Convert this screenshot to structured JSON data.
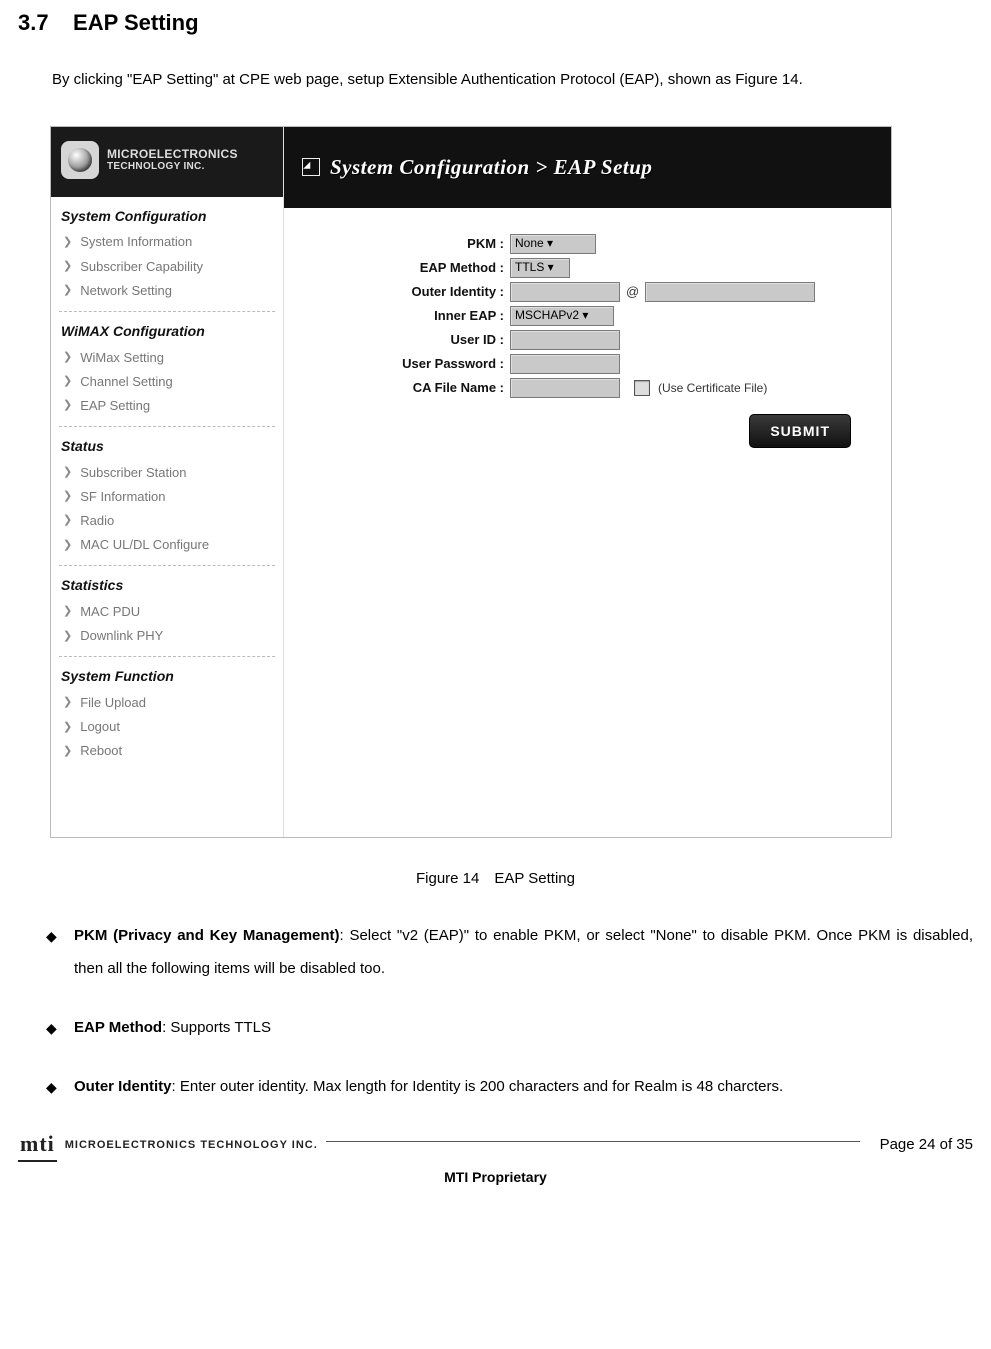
{
  "section_number": "3.7",
  "section_title": "EAP Setting",
  "intro": "By clicking \"EAP Setting\" at CPE web page, setup Extensible Authentication Protocol (EAP), shown as Figure 14.",
  "brand_line1": "MICROELECTRONICS",
  "brand_line2": "TECHNOLOGY INC.",
  "nav": {
    "system_configuration": {
      "title": "System Configuration",
      "items": [
        "System Information",
        "Subscriber Capability",
        "Network Setting"
      ]
    },
    "wimax_configuration": {
      "title": "WiMAX Configuration",
      "items": [
        "WiMax Setting",
        "Channel Setting",
        "EAP Setting"
      ]
    },
    "status": {
      "title": "Status",
      "items": [
        "Subscriber Station",
        "SF Information",
        "Radio",
        "MAC UL/DL Configure"
      ]
    },
    "statistics": {
      "title": "Statistics",
      "items": [
        "MAC PDU",
        "Downlink PHY"
      ]
    },
    "system_function": {
      "title": "System Function",
      "items": [
        "File Upload",
        "Logout",
        "Reboot"
      ]
    }
  },
  "page_title": "System Configuration > EAP Setup",
  "form": {
    "pkm_label": "PKM :",
    "pkm_value": "None",
    "eap_method_label": "EAP Method :",
    "eap_method_value": "TTLS",
    "outer_identity_label": "Outer Identity :",
    "outer_identity_value": "",
    "outer_identity_realm": "",
    "at": "@",
    "inner_eap_label": "Inner EAP :",
    "inner_eap_value": "MSCHAPv2",
    "user_id_label": "User ID :",
    "user_id_value": "",
    "user_password_label": "User Password :",
    "user_password_value": "",
    "ca_file_label": "CA File Name :",
    "ca_file_value": "",
    "use_certificate_label": "(Use Certificate File)",
    "submit": "SUBMIT"
  },
  "figure_caption": "Figure 14 EAP Setting",
  "bullets": {
    "pkm_b": "PKM (Privacy and Key Management)",
    "pkm_t": ": Select \"v2 (EAP)\" to enable PKM, or select \"None\" to disable PKM. Once PKM is disabled, then all the following items will be disabled too.",
    "eapm_b": "EAP Method",
    "eapm_t": ": Supports TTLS",
    "outer_b": "Outer Identity",
    "outer_t": ": Enter outer identity. Max length for Identity is 200 characters and for Realm is 48 charcters."
  },
  "footer": {
    "mark": "mti",
    "company": "MICROELECTRONICS TECHNOLOGY INC.",
    "center": "MTI Proprietary",
    "page": "Page 24 of 35"
  }
}
